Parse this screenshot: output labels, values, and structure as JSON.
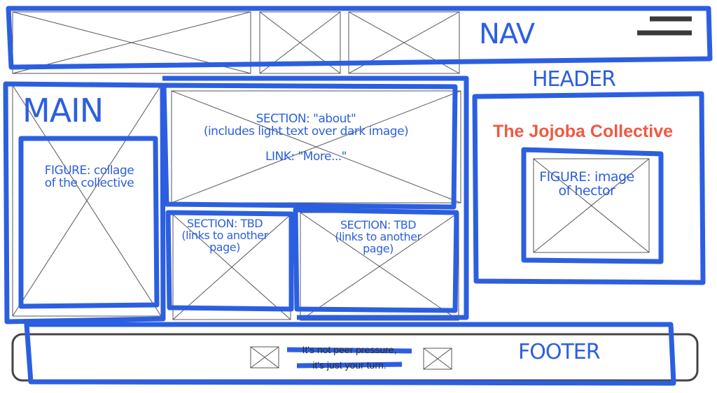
{
  "labels": {
    "nav": "NAV",
    "header": "HEADER",
    "main": "MAIN",
    "footer": "FOOTER",
    "figure_collage": [
      "FIGURE: collage",
      "of the collective"
    ],
    "section_about": [
      "SECTION: \"about\"",
      "(includes light text over dark image)"
    ],
    "link_more": "LINK: \"More...\"",
    "section_tbd_1": [
      "SECTION: TBD",
      "(links to another",
      "page)"
    ],
    "section_tbd_2": [
      "SECTION: TBD",
      "(links to another",
      "page)"
    ],
    "figure_hector": [
      "FIGURE: image",
      "of hector"
    ]
  },
  "header": {
    "title": "The Jojoba Collective"
  },
  "footer": {
    "tagline": [
      "It's not peer pressure,",
      "it's just your turn."
    ]
  },
  "colors": {
    "annotation": "#2c5fe0",
    "title": "#ef5a43",
    "wire": "#3a3a3a"
  }
}
